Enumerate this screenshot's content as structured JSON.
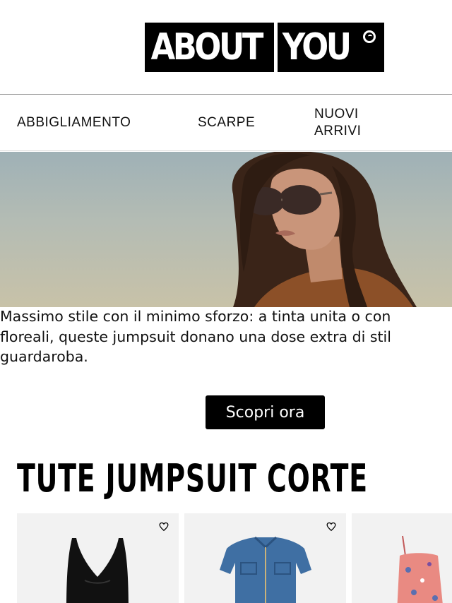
{
  "brand": {
    "logo_left": "ABOUT",
    "logo_right": "YOU"
  },
  "nav": {
    "items": [
      {
        "label": "ABBIGLIAMENTO"
      },
      {
        "label": "SCARPE"
      },
      {
        "label": "NUOVI\nARRIVI"
      }
    ]
  },
  "hero": {
    "image": "woman-with-sunglasses-photo"
  },
  "description": {
    "text": "Massimo stile con il minimo sforzo: a tinta unita o con\nfloreali, queste jumpsuit donano una dose extra di stil\nguardaroba."
  },
  "cta": {
    "label": "Scopri ora"
  },
  "section": {
    "title": "TUTE JUMPSUIT CORTE"
  },
  "products": [
    {
      "image": "black-jumpsuit",
      "icon": "heart-icon"
    },
    {
      "image": "denim-jumpsuit",
      "icon": "heart-icon"
    },
    {
      "image": "floral-jumpsuit"
    }
  ],
  "colors": {
    "accent": "#000000",
    "background": "#ffffff",
    "card_bg": "#f2f2f2"
  }
}
